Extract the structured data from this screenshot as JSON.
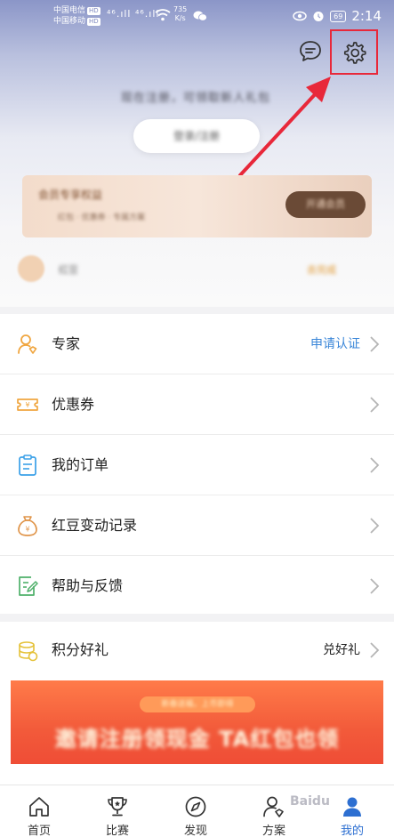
{
  "status_bar": {
    "carrier1": "中国电信",
    "carrier2": "中国移动",
    "hd": "HD",
    "signal": "⁴⁶.ıll ⁴⁶.ıll",
    "speed_value": "735",
    "speed_unit": "K/s",
    "battery": "69",
    "time": "2:14"
  },
  "login": {
    "prompt": "现在注册，可领取新人礼包",
    "button": "登录/注册"
  },
  "vip": {
    "title": "会员专享权益",
    "subtitle": "红包 · 优惠券 · 专属方案",
    "button": "开通会员"
  },
  "user": {
    "name": "红豆",
    "tag": "去完成"
  },
  "menu": {
    "items": [
      {
        "label": "专家",
        "right": "申请认证",
        "icon": "expert-icon"
      },
      {
        "label": "优惠券",
        "right": "",
        "icon": "coupon-icon"
      },
      {
        "label": "我的订单",
        "right": "",
        "icon": "order-icon"
      },
      {
        "label": "红豆变动记录",
        "right": "",
        "icon": "money-bag-icon"
      },
      {
        "label": "帮助与反馈",
        "right": "",
        "icon": "feedback-icon"
      }
    ]
  },
  "points": {
    "label": "积分好礼",
    "right": "兑好礼"
  },
  "promo": {
    "pill": "新春送福，上币即得",
    "text": "邀请注册领现金 TA红包也领"
  },
  "tabs": [
    {
      "label": "首页",
      "icon": "home-icon"
    },
    {
      "label": "比赛",
      "icon": "trophy-icon"
    },
    {
      "label": "发现",
      "icon": "compass-icon"
    },
    {
      "label": "方案",
      "icon": "plan-icon"
    },
    {
      "label": "我的",
      "icon": "profile-icon"
    }
  ],
  "watermark": "Baidu",
  "colors": {
    "accent": "#3a86d8",
    "highlight": "#e8283a",
    "active_tab": "#2d6fd1"
  }
}
